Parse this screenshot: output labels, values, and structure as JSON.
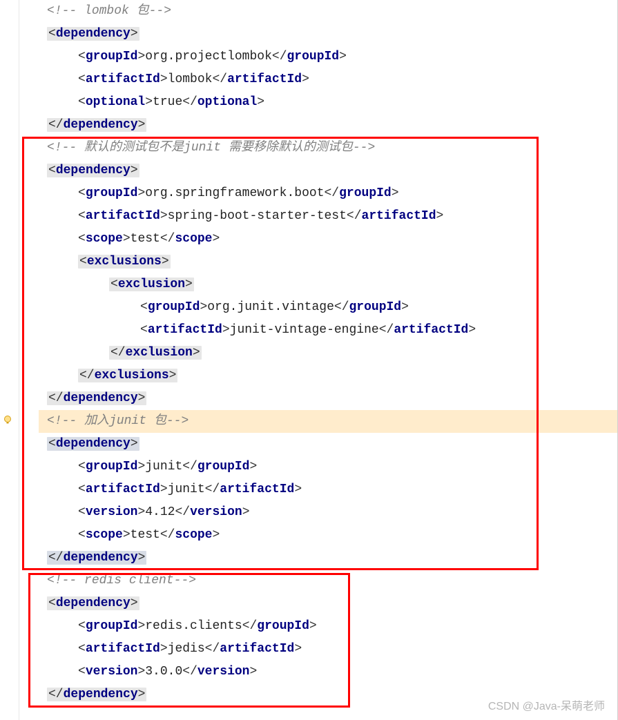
{
  "watermark": "CSDN @Java-呆萌老师",
  "comments": {
    "lombok": "!-- lombok 包--",
    "test": "!-- 默认的测试包不是junit 需要移除默认的测试包--",
    "junit": "!-- 加入junit 包--",
    "redis": "!-- redis client--"
  },
  "deps": [
    {
      "groupId": "org.projectlombok",
      "artifactId": "lombok",
      "optional": "true"
    },
    {
      "groupId": "org.springframework.boot",
      "artifactId": "spring-boot-starter-test",
      "scope": "test",
      "exclusions": [
        {
          "groupId": "org.junit.vintage",
          "artifactId": "junit-vintage-engine"
        }
      ]
    },
    {
      "groupId": "junit",
      "artifactId": "junit",
      "version": "4.12",
      "scope": "test"
    },
    {
      "groupId": "redis.clients",
      "artifactId": "jedis",
      "version": "3.0.0"
    }
  ],
  "tags": {
    "dependency": "dependency",
    "groupId": "groupId",
    "artifactId": "artifactId",
    "optional": "optional",
    "scope": "scope",
    "version": "version",
    "exclusions": "exclusions",
    "exclusion": "exclusion"
  }
}
